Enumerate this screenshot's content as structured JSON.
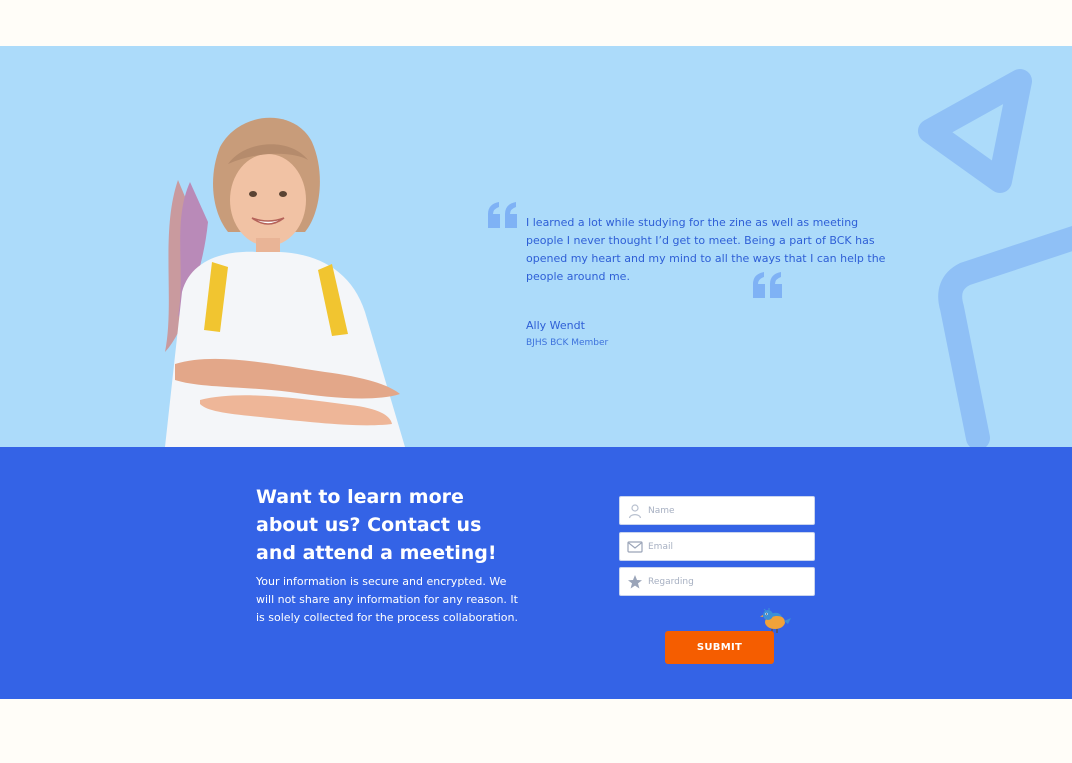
{
  "testimonial": {
    "quote": "I learned a lot while studying for the zine as well as meeting people I never thought I’d get to meet. Being a part of BCK has opened my heart and my mind to all the ways that I can help the people around me.",
    "author_name": "Ally Wendt",
    "author_role": "BJHS BCK Member",
    "photo": "smiling-student-portrait",
    "background_color": "#acdbfa",
    "accent_color": "#2e5fd6"
  },
  "contact": {
    "title": "Want to learn more about us? Contact us and attend a meeting!",
    "description": "Your information is secure and encrypted. We will not share any information for any reason. It is solely collected for the process collaboration.",
    "background_color": "#3463e6",
    "fields": {
      "name": {
        "placeholder": "Name",
        "icon": "user-icon",
        "value": ""
      },
      "email": {
        "placeholder": "Email",
        "icon": "envelope-icon",
        "value": ""
      },
      "regarding": {
        "placeholder": "Regarding",
        "icon": "star-icon",
        "value": ""
      }
    },
    "submit_label": "SUBMIT",
    "submit_color": "#f55d00"
  }
}
